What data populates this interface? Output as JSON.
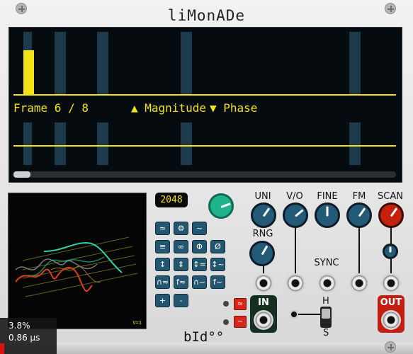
{
  "module": {
    "title": "liMonADe",
    "brand": "bId°°"
  },
  "display": {
    "frame_text": "Frame 6 / 8",
    "magnitude_label": "▲ Magnitude",
    "phase_label": "▼ Phase",
    "accent_color": "#f2e314"
  },
  "wavetable": {
    "size_label": "2048",
    "buttons": [
      {
        "symbol": "≈"
      },
      {
        "symbol": "⚙"
      },
      {
        "symbol": "~"
      },
      {
        "symbol": "≡"
      },
      {
        "symbol": "∞"
      },
      {
        "symbol": "Φ"
      },
      {
        "symbol": "Ø"
      },
      {
        "symbol": "↕"
      },
      {
        "symbol": "⇕"
      },
      {
        "symbol": "↕≈"
      },
      {
        "symbol": "↕~"
      },
      {
        "symbol": "∩≈"
      },
      {
        "symbol": "f≈"
      },
      {
        "symbol": "∩~"
      },
      {
        "symbol": "f~"
      },
      {
        "symbol": "+"
      },
      {
        "symbol": "-"
      }
    ],
    "scope_badge": "V=1"
  },
  "knobs": {
    "uni": "UNI",
    "vo": "V/O",
    "fine": "FINE",
    "fm": "FM",
    "scan": "SCAN",
    "rng": "RNG",
    "sync": "SYNC"
  },
  "io": {
    "in_label": "IN",
    "out_label": "OUT",
    "h_label": "H",
    "s_label": "S",
    "red_btn_1": "≈",
    "red_btn_2": "~"
  },
  "cpu_meter": {
    "percent": "3.8%",
    "time": "0.86 µs"
  }
}
